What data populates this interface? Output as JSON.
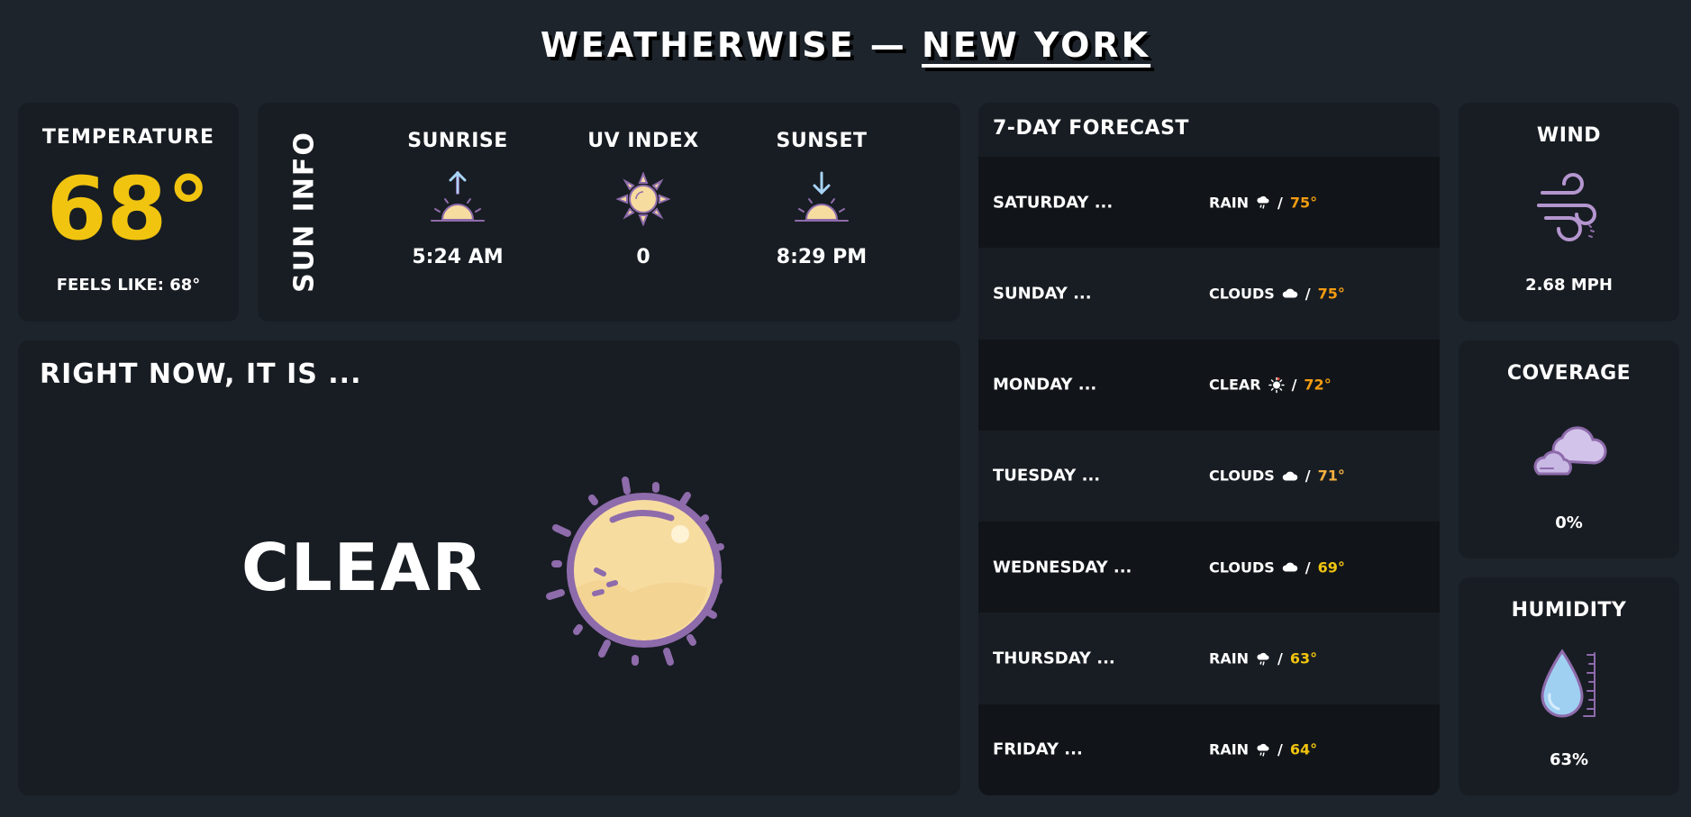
{
  "header": {
    "app": "WEATHERWISE —",
    "city": "NEW YORK"
  },
  "temperature": {
    "label": "TEMPERATURE",
    "value": "68°",
    "feels_like": "FEELS LIKE: 68°"
  },
  "sun_info": {
    "title": "SUN INFO",
    "sunrise": {
      "label": "SUNRISE",
      "value": "5:24 AM",
      "icon": "sunrise-icon"
    },
    "uv_index": {
      "label": "UV INDEX",
      "value": "0",
      "icon": "sun-icon"
    },
    "sunset": {
      "label": "SUNSET",
      "value": "8:29 PM",
      "icon": "sunset-icon"
    }
  },
  "now": {
    "heading": "RIGHT NOW, IT IS ...",
    "condition": "CLEAR",
    "icon": "sun-icon"
  },
  "forecast": {
    "title": "7-DAY FORECAST",
    "days": [
      {
        "day": "SATURDAY ...",
        "condition": "RAIN",
        "icon": "rain-icon",
        "temp": "75°",
        "temp_color": "#f39c12"
      },
      {
        "day": "SUNDAY ...",
        "condition": "CLOUDS",
        "icon": "cloud-icon",
        "temp": "75°",
        "temp_color": "#f39c12"
      },
      {
        "day": "MONDAY ...",
        "condition": "CLEAR",
        "icon": "sun-icon",
        "temp": "72°",
        "temp_color": "#f39c12"
      },
      {
        "day": "TUESDAY ...",
        "condition": "CLOUDS",
        "icon": "cloud-icon",
        "temp": "71°",
        "temp_color": "#f5b041"
      },
      {
        "day": "WEDNESDAY ...",
        "condition": "CLOUDS",
        "icon": "cloud-icon",
        "temp": "69°",
        "temp_color": "#f1c40f"
      },
      {
        "day": "THURSDAY ...",
        "condition": "RAIN",
        "icon": "rain-icon",
        "temp": "63°",
        "temp_color": "#f1c40f"
      },
      {
        "day": "FRIDAY ...",
        "condition": "RAIN",
        "icon": "rain-icon",
        "temp": "64°",
        "temp_color": "#f1c40f"
      }
    ]
  },
  "wind": {
    "label": "WIND",
    "value": "2.68 MPH",
    "icon": "wind-icon"
  },
  "coverage": {
    "label": "COVERAGE",
    "value": "0%",
    "icon": "clouds-icon"
  },
  "humidity": {
    "label": "HUMIDITY",
    "value": "63%",
    "icon": "droplet-icon"
  },
  "colors": {
    "background": "#1e242b",
    "card": "#181d23",
    "temp_accent": "#f1c40f",
    "icon_outline": "#8e6bab"
  }
}
